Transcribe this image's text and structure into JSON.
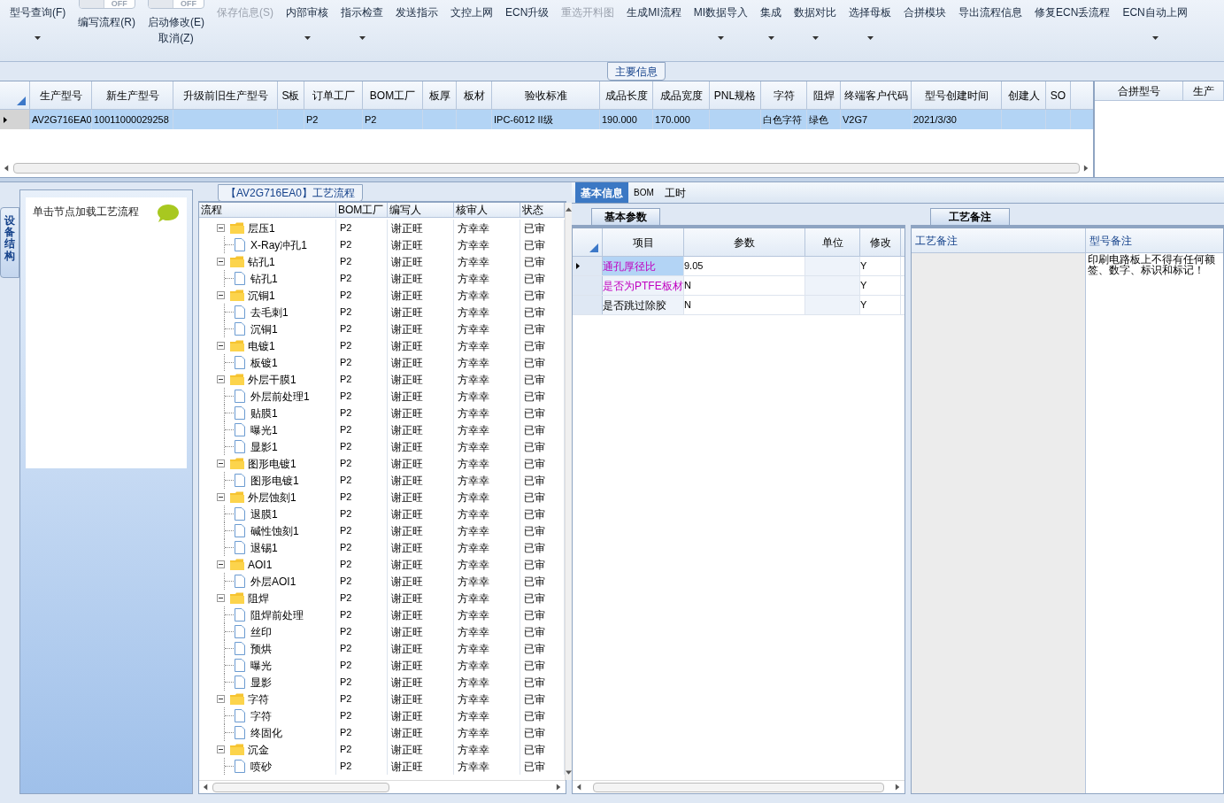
{
  "toolbar": [
    {
      "label": "型号查询(F)",
      "disabled": false,
      "dropdown": true
    },
    {
      "label": "编写流程(R)",
      "disabled": false,
      "dropdown": false,
      "toggle": "OFF",
      "on": false
    },
    {
      "label": "启动修改(E)",
      "disabled": false,
      "dropdown": false,
      "toggle": "OFF",
      "on": false,
      "sublabel": "取消(Z)"
    },
    {
      "label": "保存信息(S)",
      "disabled": true,
      "dropdown": false
    },
    {
      "label": "内部审核",
      "disabled": false,
      "dropdown": true
    },
    {
      "label": "指示检查",
      "disabled": false,
      "dropdown": true
    },
    {
      "label": "发送指示",
      "disabled": false,
      "dropdown": false
    },
    {
      "label": "文控上网",
      "disabled": false,
      "dropdown": false
    },
    {
      "label": "ECN升级",
      "disabled": false,
      "dropdown": false
    },
    {
      "label": "重选开料图",
      "disabled": true,
      "dropdown": false
    },
    {
      "label": "生成MI流程",
      "disabled": false,
      "dropdown": false
    },
    {
      "label": "MI数据导入",
      "disabled": false,
      "dropdown": true
    },
    {
      "label": "集成",
      "disabled": false,
      "dropdown": true
    },
    {
      "label": "数据对比",
      "disabled": false,
      "dropdown": true
    },
    {
      "label": "选择母板",
      "disabled": false,
      "dropdown": true
    },
    {
      "label": "合拼模块",
      "disabled": false,
      "dropdown": false
    },
    {
      "label": "导出流程信息",
      "disabled": false,
      "dropdown": false
    },
    {
      "label": "修复ECN丢流程",
      "disabled": false,
      "dropdown": false
    },
    {
      "label": "ECN自动上网",
      "disabled": false,
      "dropdown": true
    }
  ],
  "main_info": {
    "tab": "主要信息",
    "columns": [
      "生产型号",
      "新生产型号",
      "升级前旧生产型号",
      "S板",
      "订单工厂",
      "BOM工厂",
      "板厚",
      "板材",
      "验收标准",
      "成品长度",
      "成品宽度",
      "PNL规格",
      "字符",
      "阻焊",
      "终端客户代码",
      "型号创建时间",
      "创建人",
      "SO"
    ],
    "rows": [
      {
        "selected": true,
        "cells": [
          "AV2G716EA0",
          "10011000029258",
          "",
          "",
          "P2",
          "P2",
          "",
          "",
          "IPC-6012 II级",
          "190.000",
          "170.000",
          "",
          "白色字符",
          "绿色",
          "V2G7",
          "2021/3/30",
          "",
          ""
        ]
      }
    ],
    "side_columns": [
      "合拼型号",
      "生产"
    ]
  },
  "left_panel": {
    "vertical_tab": "设备结构",
    "hint": "单击节点加载工艺流程"
  },
  "flow": {
    "tab": "【AV2G716EA0】工艺流程",
    "columns": [
      "流程",
      "BOM工厂",
      "编写人",
      "核审人",
      "状态"
    ],
    "tree": [
      {
        "name": "层压1",
        "bom": "P2",
        "writer": "谢正旺",
        "reviewer": "方幸幸",
        "status": "已审",
        "expanded": true,
        "children": [
          {
            "name": "X-Ray冲孔1",
            "bom": "P2",
            "writer": "谢正旺",
            "reviewer": "方幸幸",
            "status": "已审"
          }
        ]
      },
      {
        "name": "钻孔1",
        "bom": "P2",
        "writer": "谢正旺",
        "reviewer": "方幸幸",
        "status": "已审",
        "expanded": true,
        "children": [
          {
            "name": "钻孔1",
            "bom": "P2",
            "writer": "谢正旺",
            "reviewer": "方幸幸",
            "status": "已审"
          }
        ]
      },
      {
        "name": "沉铜1",
        "bom": "P2",
        "writer": "谢正旺",
        "reviewer": "方幸幸",
        "status": "已审",
        "expanded": true,
        "children": [
          {
            "name": "去毛刺1",
            "bom": "P2",
            "writer": "谢正旺",
            "reviewer": "方幸幸",
            "status": "已审"
          },
          {
            "name": "沉铜1",
            "bom": "P2",
            "writer": "谢正旺",
            "reviewer": "方幸幸",
            "status": "已审"
          }
        ]
      },
      {
        "name": "电镀1",
        "bom": "P2",
        "writer": "谢正旺",
        "reviewer": "方幸幸",
        "status": "已审",
        "expanded": true,
        "children": [
          {
            "name": "板镀1",
            "bom": "P2",
            "writer": "谢正旺",
            "reviewer": "方幸幸",
            "status": "已审"
          }
        ]
      },
      {
        "name": "外层干膜1",
        "bom": "P2",
        "writer": "谢正旺",
        "reviewer": "方幸幸",
        "status": "已审",
        "expanded": true,
        "children": [
          {
            "name": "外层前处理1",
            "bom": "P2",
            "writer": "谢正旺",
            "reviewer": "方幸幸",
            "status": "已审"
          },
          {
            "name": "贴膜1",
            "bom": "P2",
            "writer": "谢正旺",
            "reviewer": "方幸幸",
            "status": "已审"
          },
          {
            "name": "曝光1",
            "bom": "P2",
            "writer": "谢正旺",
            "reviewer": "方幸幸",
            "status": "已审"
          },
          {
            "name": "显影1",
            "bom": "P2",
            "writer": "谢正旺",
            "reviewer": "方幸幸",
            "status": "已审"
          }
        ]
      },
      {
        "name": "图形电镀1",
        "bom": "P2",
        "writer": "谢正旺",
        "reviewer": "方幸幸",
        "status": "已审",
        "expanded": true,
        "children": [
          {
            "name": "图形电镀1",
            "bom": "P2",
            "writer": "谢正旺",
            "reviewer": "方幸幸",
            "status": "已审"
          }
        ]
      },
      {
        "name": "外层蚀刻1",
        "bom": "P2",
        "writer": "谢正旺",
        "reviewer": "方幸幸",
        "status": "已审",
        "expanded": true,
        "children": [
          {
            "name": "退膜1",
            "bom": "P2",
            "writer": "谢正旺",
            "reviewer": "方幸幸",
            "status": "已审"
          },
          {
            "name": "碱性蚀刻1",
            "bom": "P2",
            "writer": "谢正旺",
            "reviewer": "方幸幸",
            "status": "已审"
          },
          {
            "name": "退锡1",
            "bom": "P2",
            "writer": "谢正旺",
            "reviewer": "方幸幸",
            "status": "已审"
          }
        ]
      },
      {
        "name": "AOI1",
        "bom": "P2",
        "writer": "谢正旺",
        "reviewer": "方幸幸",
        "status": "已审",
        "expanded": true,
        "children": [
          {
            "name": "外层AOI1",
            "bom": "P2",
            "writer": "谢正旺",
            "reviewer": "方幸幸",
            "status": "已审"
          }
        ]
      },
      {
        "name": "阻焊",
        "bom": "P2",
        "writer": "谢正旺",
        "reviewer": "方幸幸",
        "status": "已审",
        "expanded": true,
        "children": [
          {
            "name": "阻焊前处理",
            "bom": "P2",
            "writer": "谢正旺",
            "reviewer": "方幸幸",
            "status": "已审"
          },
          {
            "name": "丝印",
            "bom": "P2",
            "writer": "谢正旺",
            "reviewer": "方幸幸",
            "status": "已审"
          },
          {
            "name": "预烘",
            "bom": "P2",
            "writer": "谢正旺",
            "reviewer": "方幸幸",
            "status": "已审"
          },
          {
            "name": "曝光",
            "bom": "P2",
            "writer": "谢正旺",
            "reviewer": "方幸幸",
            "status": "已审"
          },
          {
            "name": "显影",
            "bom": "P2",
            "writer": "谢正旺",
            "reviewer": "方幸幸",
            "status": "已审"
          }
        ]
      },
      {
        "name": "字符",
        "bom": "P2",
        "writer": "谢正旺",
        "reviewer": "方幸幸",
        "status": "已审",
        "expanded": true,
        "children": [
          {
            "name": "字符",
            "bom": "P2",
            "writer": "谢正旺",
            "reviewer": "方幸幸",
            "status": "已审"
          },
          {
            "name": "终固化",
            "bom": "P2",
            "writer": "谢正旺",
            "reviewer": "方幸幸",
            "status": "已审"
          }
        ]
      },
      {
        "name": "沉金",
        "bom": "P2",
        "writer": "谢正旺",
        "reviewer": "方幸幸",
        "status": "已审",
        "expanded": true,
        "children": [
          {
            "name": "喷砂",
            "bom": "P2",
            "writer": "谢正旺",
            "reviewer": "方幸幸",
            "status": "已审"
          }
        ]
      }
    ]
  },
  "detail_tabs": [
    {
      "label": "基本信息",
      "selected": true
    },
    {
      "label": "BOM",
      "selected": false
    },
    {
      "label": "工时",
      "selected": false
    }
  ],
  "params": {
    "tab": "基本参数",
    "columns": [
      "项目",
      "参数",
      "单位",
      "修改"
    ],
    "rows": [
      {
        "selected": true,
        "flagged": true,
        "cells": [
          "通孔厚径比",
          "9.05",
          "",
          "Y"
        ]
      },
      {
        "selected": false,
        "flagged": true,
        "cells": [
          "是否为PTFE板材",
          "N",
          "",
          "Y"
        ]
      },
      {
        "selected": false,
        "flagged": false,
        "cells": [
          "是否跳过除胶",
          "N",
          "",
          "Y"
        ]
      }
    ]
  },
  "notes": {
    "tab": "工艺备注",
    "columns": [
      "工艺备注",
      "型号备注"
    ],
    "model_note": [
      "印刷电路板上不得有任何额",
      "签、数字、标识和标记！"
    ]
  }
}
